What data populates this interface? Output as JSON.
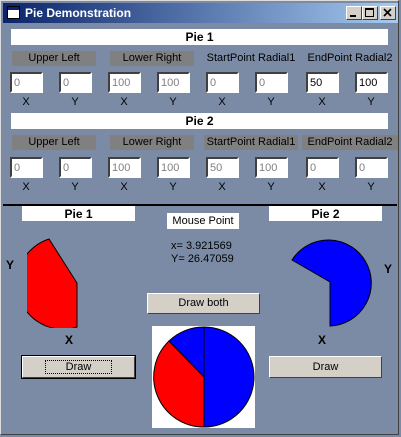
{
  "window": {
    "title": "Pie Demonstration"
  },
  "pie1": {
    "header": "Pie 1",
    "groups": [
      {
        "label": "Upper Left",
        "x": "0",
        "y": "0"
      },
      {
        "label": "Lower Right",
        "x": "100",
        "y": "100"
      },
      {
        "label": "StartPoint Radial1",
        "x": "0",
        "y": "0"
      },
      {
        "label": "EndPoint Radial2",
        "x": "50",
        "y": "100"
      }
    ]
  },
  "pie2": {
    "header": "Pie 2",
    "groups": [
      {
        "label": "Upper Left",
        "x": "0",
        "y": "0"
      },
      {
        "label": "Lower Right",
        "x": "100",
        "y": "100"
      },
      {
        "label": "StartPoint Radial1",
        "x": "50",
        "y": "100"
      },
      {
        "label": "EndPoint Radial2",
        "x": "0",
        "y": "0"
      }
    ]
  },
  "axis": {
    "x": "X",
    "y": "Y"
  },
  "bottom": {
    "pie1_title": "Pie 1",
    "pie2_title": "Pie 2",
    "mouse_point_label": "Mouse Point",
    "mouse_x": "x= 3.921569",
    "mouse_y": "Y= 26.47059",
    "draw_both": "Draw both",
    "draw1": "Draw",
    "draw2": "Draw"
  },
  "colors": {
    "pie1": "#ff0000",
    "pie2": "#0000ff",
    "background": "#7b8ba5"
  }
}
